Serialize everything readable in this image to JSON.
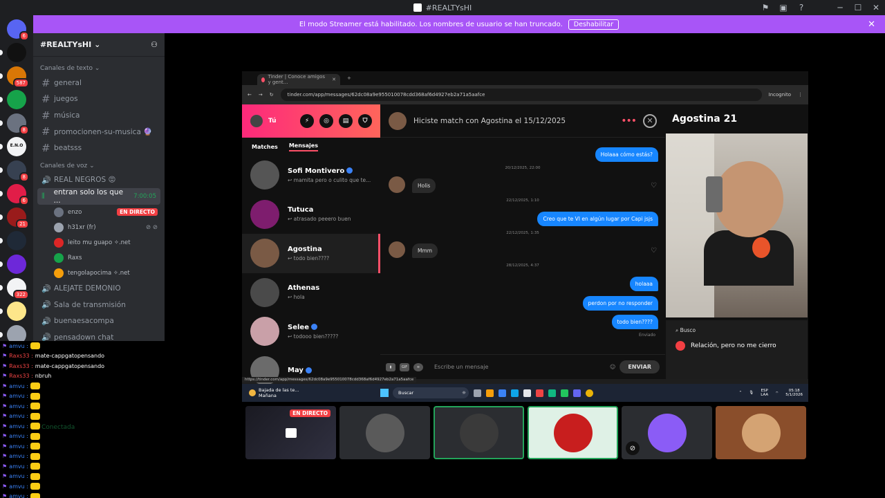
{
  "window": {
    "title": "#REALTYsHI"
  },
  "banner": {
    "text": "El modo Streamer está habilitado. Los nombres de usuario se han truncado.",
    "button": "Deshabilitar"
  },
  "guilds": [
    {
      "badge": "6",
      "color": "#5865f2"
    },
    {
      "badge": "",
      "color": "#111111"
    },
    {
      "badge": "587",
      "color": "#d97706"
    },
    {
      "badge": "",
      "color": "#16a34a"
    },
    {
      "badge": "8",
      "color": "#6b7280"
    },
    {
      "badge": "",
      "color": "#f2f3f5",
      "label": "E.N.O"
    },
    {
      "badge": "8",
      "color": "#374151"
    },
    {
      "badge": "6",
      "color": "#e11d48"
    },
    {
      "badge": "21",
      "color": "#991b1b"
    },
    {
      "badge": "",
      "color": "#1f2937"
    },
    {
      "badge": "",
      "color": "#6d28d9"
    },
    {
      "badge": "322",
      "color": "#f2f3f5"
    },
    {
      "badge": "",
      "color": "#fde68a"
    },
    {
      "badge": "",
      "color": "#9ca3af"
    }
  ],
  "server": {
    "name": "#REALTYsHI",
    "text_category": "Canales de texto",
    "text_channels": [
      "general",
      "juegos",
      "música",
      "promocionen-su-musica 🔮",
      "beatsss"
    ],
    "voice_category": "Canales de voz",
    "voice_channels": [
      "REAL NEGROS 😡",
      "ALEJATE DEMONIO",
      "Sala de transmisión",
      "buenaesacompa",
      "pensadown chat"
    ],
    "active_voice": {
      "name": "entran solo los que ...",
      "time": "7:00:05"
    },
    "voice_users": [
      {
        "name": "enzo",
        "live": "EN DIRECTO"
      },
      {
        "name": "h31xr (fr)",
        "live": ""
      },
      {
        "name": "leito mu guapo ✧.net",
        "live": ""
      },
      {
        "name": "Raxs",
        "live": ""
      },
      {
        "name": "tengolapocima ✧.net",
        "live": ""
      }
    ]
  },
  "chat_log": [
    {
      "user": "amvu :",
      "msg": "",
      "red": false
    },
    {
      "user": "Raxs33 :",
      "msg": "mate-cappgatopensando",
      "red": true
    },
    {
      "user": "Raxs33 :",
      "msg": "mate-cappgatopensando",
      "red": true
    },
    {
      "user": "Raxs33 :",
      "msg": "nbruh",
      "red": true
    },
    {
      "user": "amvu :",
      "msg": "",
      "red": false
    },
    {
      "user": "amvu :",
      "msg": "",
      "red": false
    },
    {
      "user": "amvu :",
      "msg": "",
      "red": false
    },
    {
      "user": "amvu :",
      "msg": "",
      "red": false
    },
    {
      "user": "amvu :",
      "msg": "",
      "red": false
    },
    {
      "user": "amvu :",
      "msg": "",
      "red": false
    },
    {
      "user": "amvu :",
      "msg": "",
      "red": false
    },
    {
      "user": "amvu :",
      "msg": "",
      "red": false
    },
    {
      "user": "amvu :",
      "msg": "",
      "red": false
    },
    {
      "user": "amvu :",
      "msg": "",
      "red": false
    },
    {
      "user": "amvu :",
      "msg": "",
      "red": false
    },
    {
      "user": "amvu :",
      "msg": "",
      "red": false
    }
  ],
  "overlay_status": "Conectada",
  "browser": {
    "tab_title": "Tinder | Conoce amigos y gent...",
    "url": "tinder.com/app/messages/62dc08a9e955010078cdd368af6d4927eb2a71a5aafce",
    "incognito": "Incognito",
    "status_url": "https://tinder.com/app/messages/62dc08a9e955010078cdd368af6d4927eb2a71a5aafce"
  },
  "tinder": {
    "me_label": "Tú",
    "tabs": [
      "Matches",
      "Mensajes"
    ],
    "matches": [
      {
        "name": "Sofi Montivero",
        "preview": "↩ mamita pero o culito que te...",
        "verified": true,
        "color": "#555555"
      },
      {
        "name": "Tutuca",
        "preview": "↩ atrasado peeero buen",
        "verified": false,
        "color": "#7e1d6e"
      },
      {
        "name": "Agostina",
        "preview": "↩ todo bien????",
        "verified": false,
        "color": "#7a5a45"
      },
      {
        "name": "Athenas",
        "preview": "↩ hola",
        "verified": false,
        "color": "#4a4a4a"
      },
      {
        "name": "Selee",
        "preview": "↩ todooo bien?????",
        "verified": true,
        "color": "#c9a0a8"
      },
      {
        "name": "May",
        "preview": "",
        "verified": true,
        "color": "#6b6b6b"
      }
    ],
    "chat_header": "Hiciste match con Agostina el 15/12/2025",
    "messages": {
      "m1": "Holaaa cómo estás?",
      "t1": "20/12/2025, 22:00",
      "m2": "Holis",
      "t2": "22/12/2025, 1:10",
      "m3": "Creo que te VI en algún lugar por Capi jsjs",
      "t3": "22/12/2025, 1:35",
      "m4": "Mmm",
      "t4": "28/12/2025, 4:37",
      "m5": "holaaa",
      "m6": "perdon por no responder",
      "m7": "todo bien????",
      "sent": "Enviado"
    },
    "composer_placeholder": "Escribe un mensaje",
    "send_label": "ENVIAR",
    "profile": {
      "name_age": "Agostina 21",
      "busco_label": "Busco",
      "relation": "Relación, pero no me cierro"
    }
  },
  "taskbar": {
    "weather": "Bajada de las te...",
    "weather_sub": "Mañana",
    "search": "Buscar",
    "lang": "ESP",
    "lang2": "LAA",
    "time": "05:18",
    "date": "5/1/2026"
  },
  "tiles": {
    "live": "EN DIRECTO"
  }
}
